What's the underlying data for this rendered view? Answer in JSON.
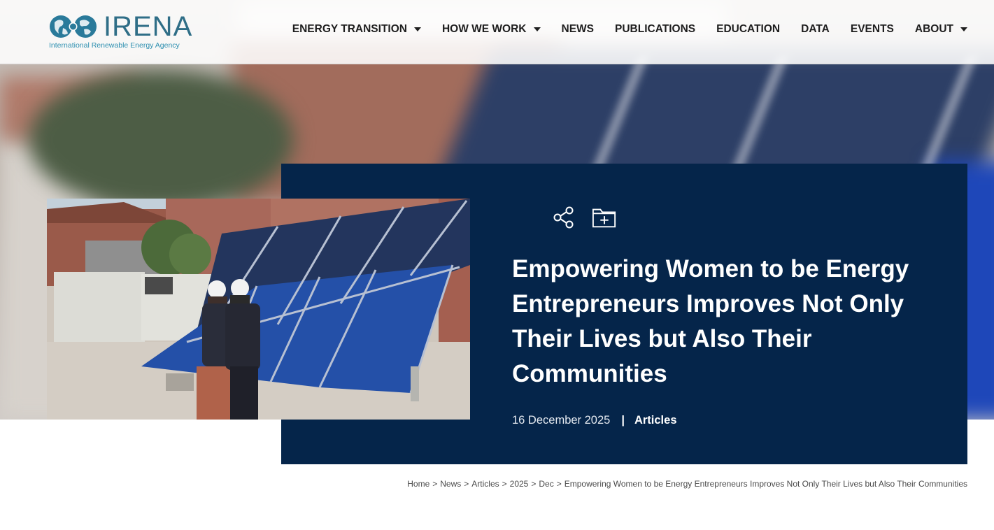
{
  "brand": {
    "name": "IRENA",
    "tagline": "International Renewable Energy Agency",
    "color": "#2f6e87"
  },
  "nav": {
    "items": [
      {
        "label": "ENERGY TRANSITION",
        "has_dropdown": true
      },
      {
        "label": "HOW WE WORK",
        "has_dropdown": true
      },
      {
        "label": "NEWS",
        "has_dropdown": false
      },
      {
        "label": "PUBLICATIONS",
        "has_dropdown": false
      },
      {
        "label": "EDUCATION",
        "has_dropdown": false
      },
      {
        "label": "DATA",
        "has_dropdown": false
      },
      {
        "label": "EVENTS",
        "has_dropdown": false
      },
      {
        "label": "ABOUT",
        "has_dropdown": true
      }
    ]
  },
  "article": {
    "title": "Empowering Women to be Energy Entrepreneurs Improves Not Only Their Lives but Also Their Communities",
    "date": "16 December 2025",
    "separator": "|",
    "category": "Articles",
    "actions": [
      {
        "icon": "share-icon"
      },
      {
        "icon": "add-to-folder-icon"
      }
    ],
    "card_color": "#05254a"
  },
  "breadcrumb": {
    "items": [
      "Home",
      "News",
      "Articles",
      "2025",
      "Dec",
      "Empowering Women to be Energy Entrepreneurs Improves Not Only Their Lives but Also Their Communities"
    ],
    "separator": ">"
  }
}
